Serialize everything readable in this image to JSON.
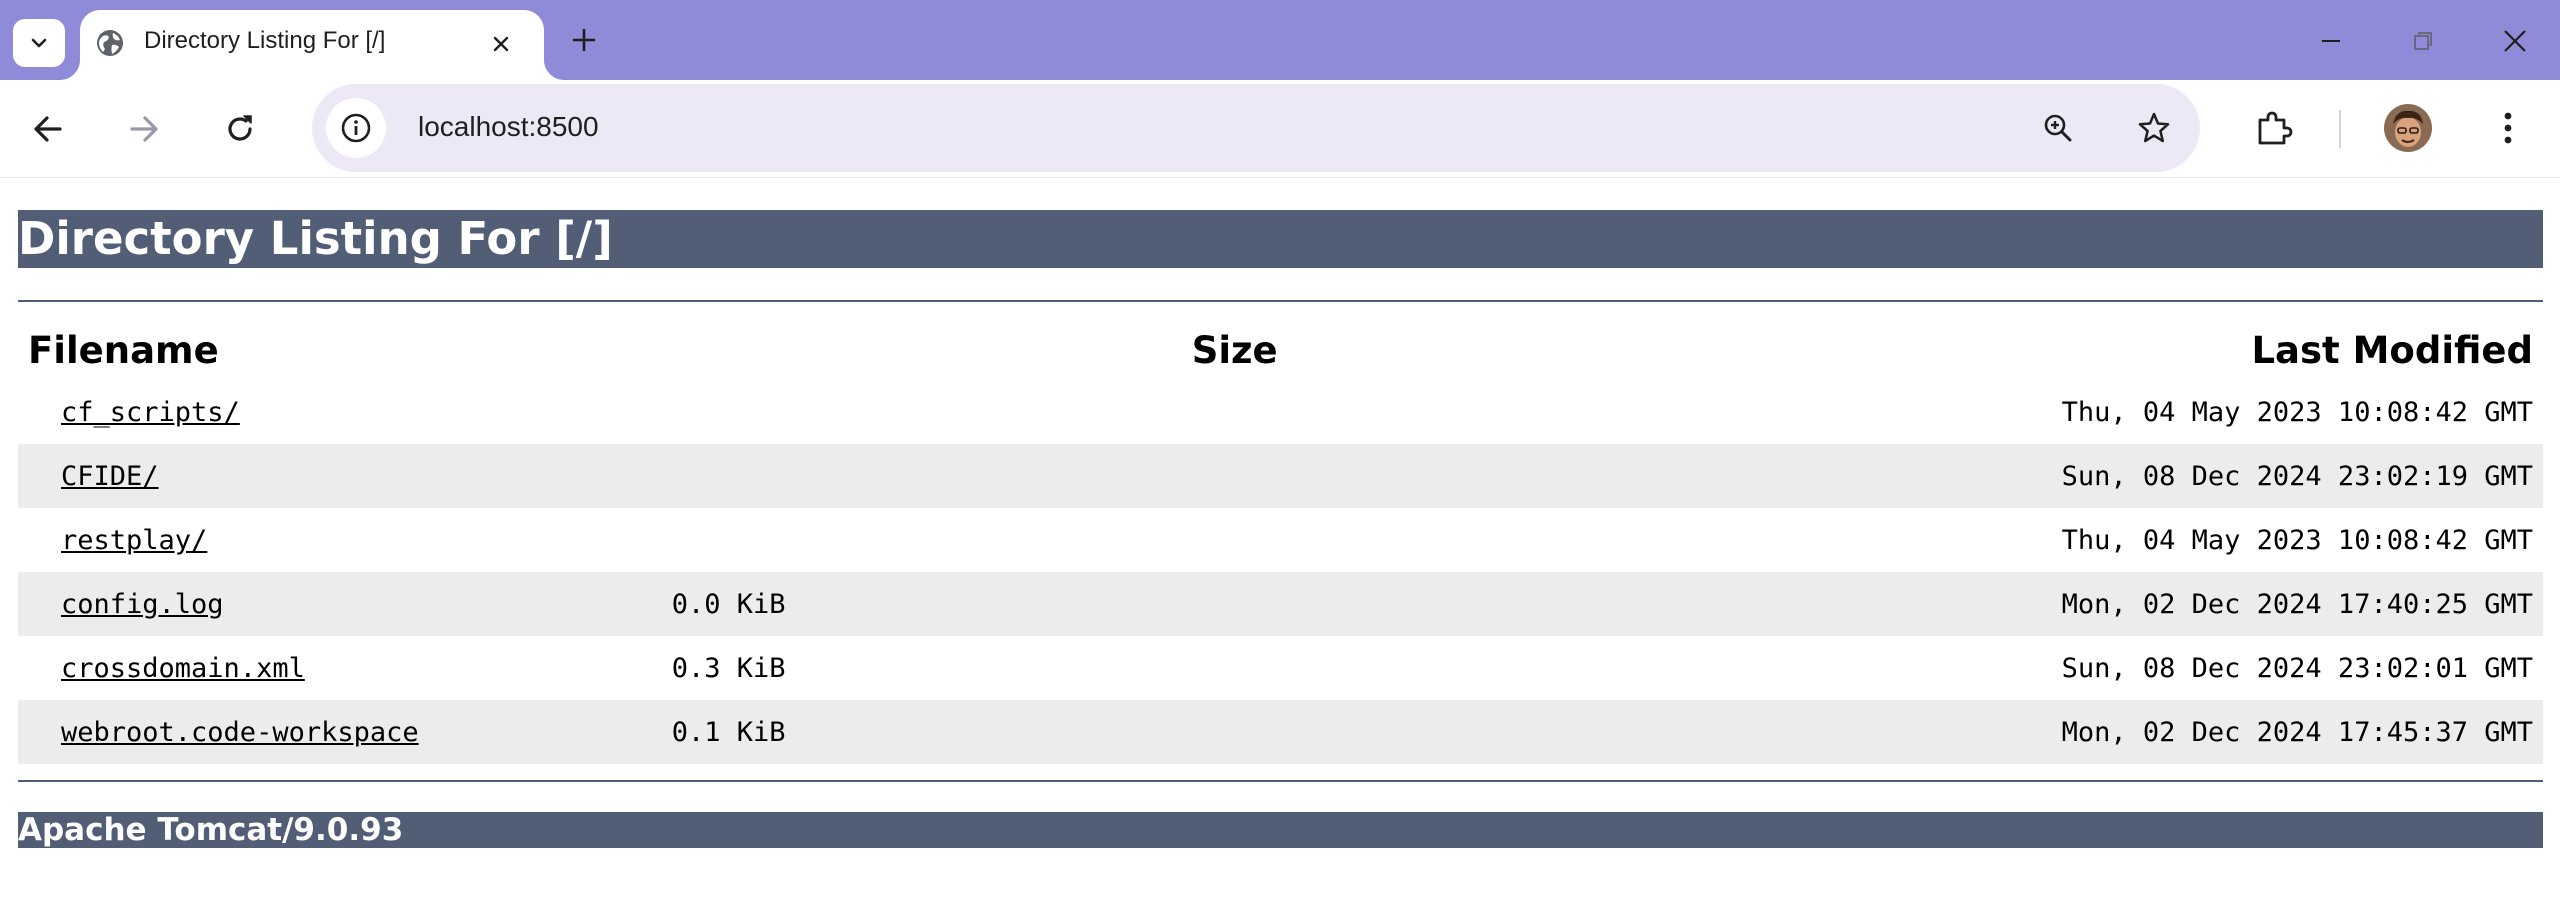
{
  "browser": {
    "tab_title": "Directory Listing For [/]",
    "url": "localhost:8500"
  },
  "page": {
    "heading": "Directory Listing For [/]",
    "columns": {
      "filename": "Filename",
      "size": "Size",
      "modified": "Last Modified"
    },
    "rows": [
      {
        "name": "cf_scripts/",
        "size": "",
        "modified": "Thu, 04 May 2023 10:08:42 GMT"
      },
      {
        "name": "CFIDE/",
        "size": "",
        "modified": "Sun, 08 Dec 2024 23:02:19 GMT"
      },
      {
        "name": "restplay/",
        "size": "",
        "modified": "Thu, 04 May 2023 10:08:42 GMT"
      },
      {
        "name": "config.log",
        "size": "0.0 KiB",
        "modified": "Mon, 02 Dec 2024 17:40:25 GMT"
      },
      {
        "name": "crossdomain.xml",
        "size": "0.3 KiB",
        "modified": "Sun, 08 Dec 2024 23:02:01 GMT"
      },
      {
        "name": "webroot.code-workspace",
        "size": "0.1 KiB",
        "modified": "Mon, 02 Dec 2024 17:45:37 GMT"
      }
    ],
    "footer": "Apache Tomcat/9.0.93"
  },
  "colors": {
    "tabbar_bg": "#8f8bd8",
    "omnibox_bg": "#ece8f6",
    "header_bar": "#525d76",
    "row_alt": "#ececec"
  },
  "icons": [
    "tab-search-icon",
    "globe-icon",
    "close-icon",
    "plus-icon",
    "minimize-icon",
    "restore-icon",
    "back-icon",
    "forward-icon",
    "reload-icon",
    "info-icon",
    "zoom-icon",
    "star-icon",
    "extensions-icon",
    "menu-icon"
  ]
}
